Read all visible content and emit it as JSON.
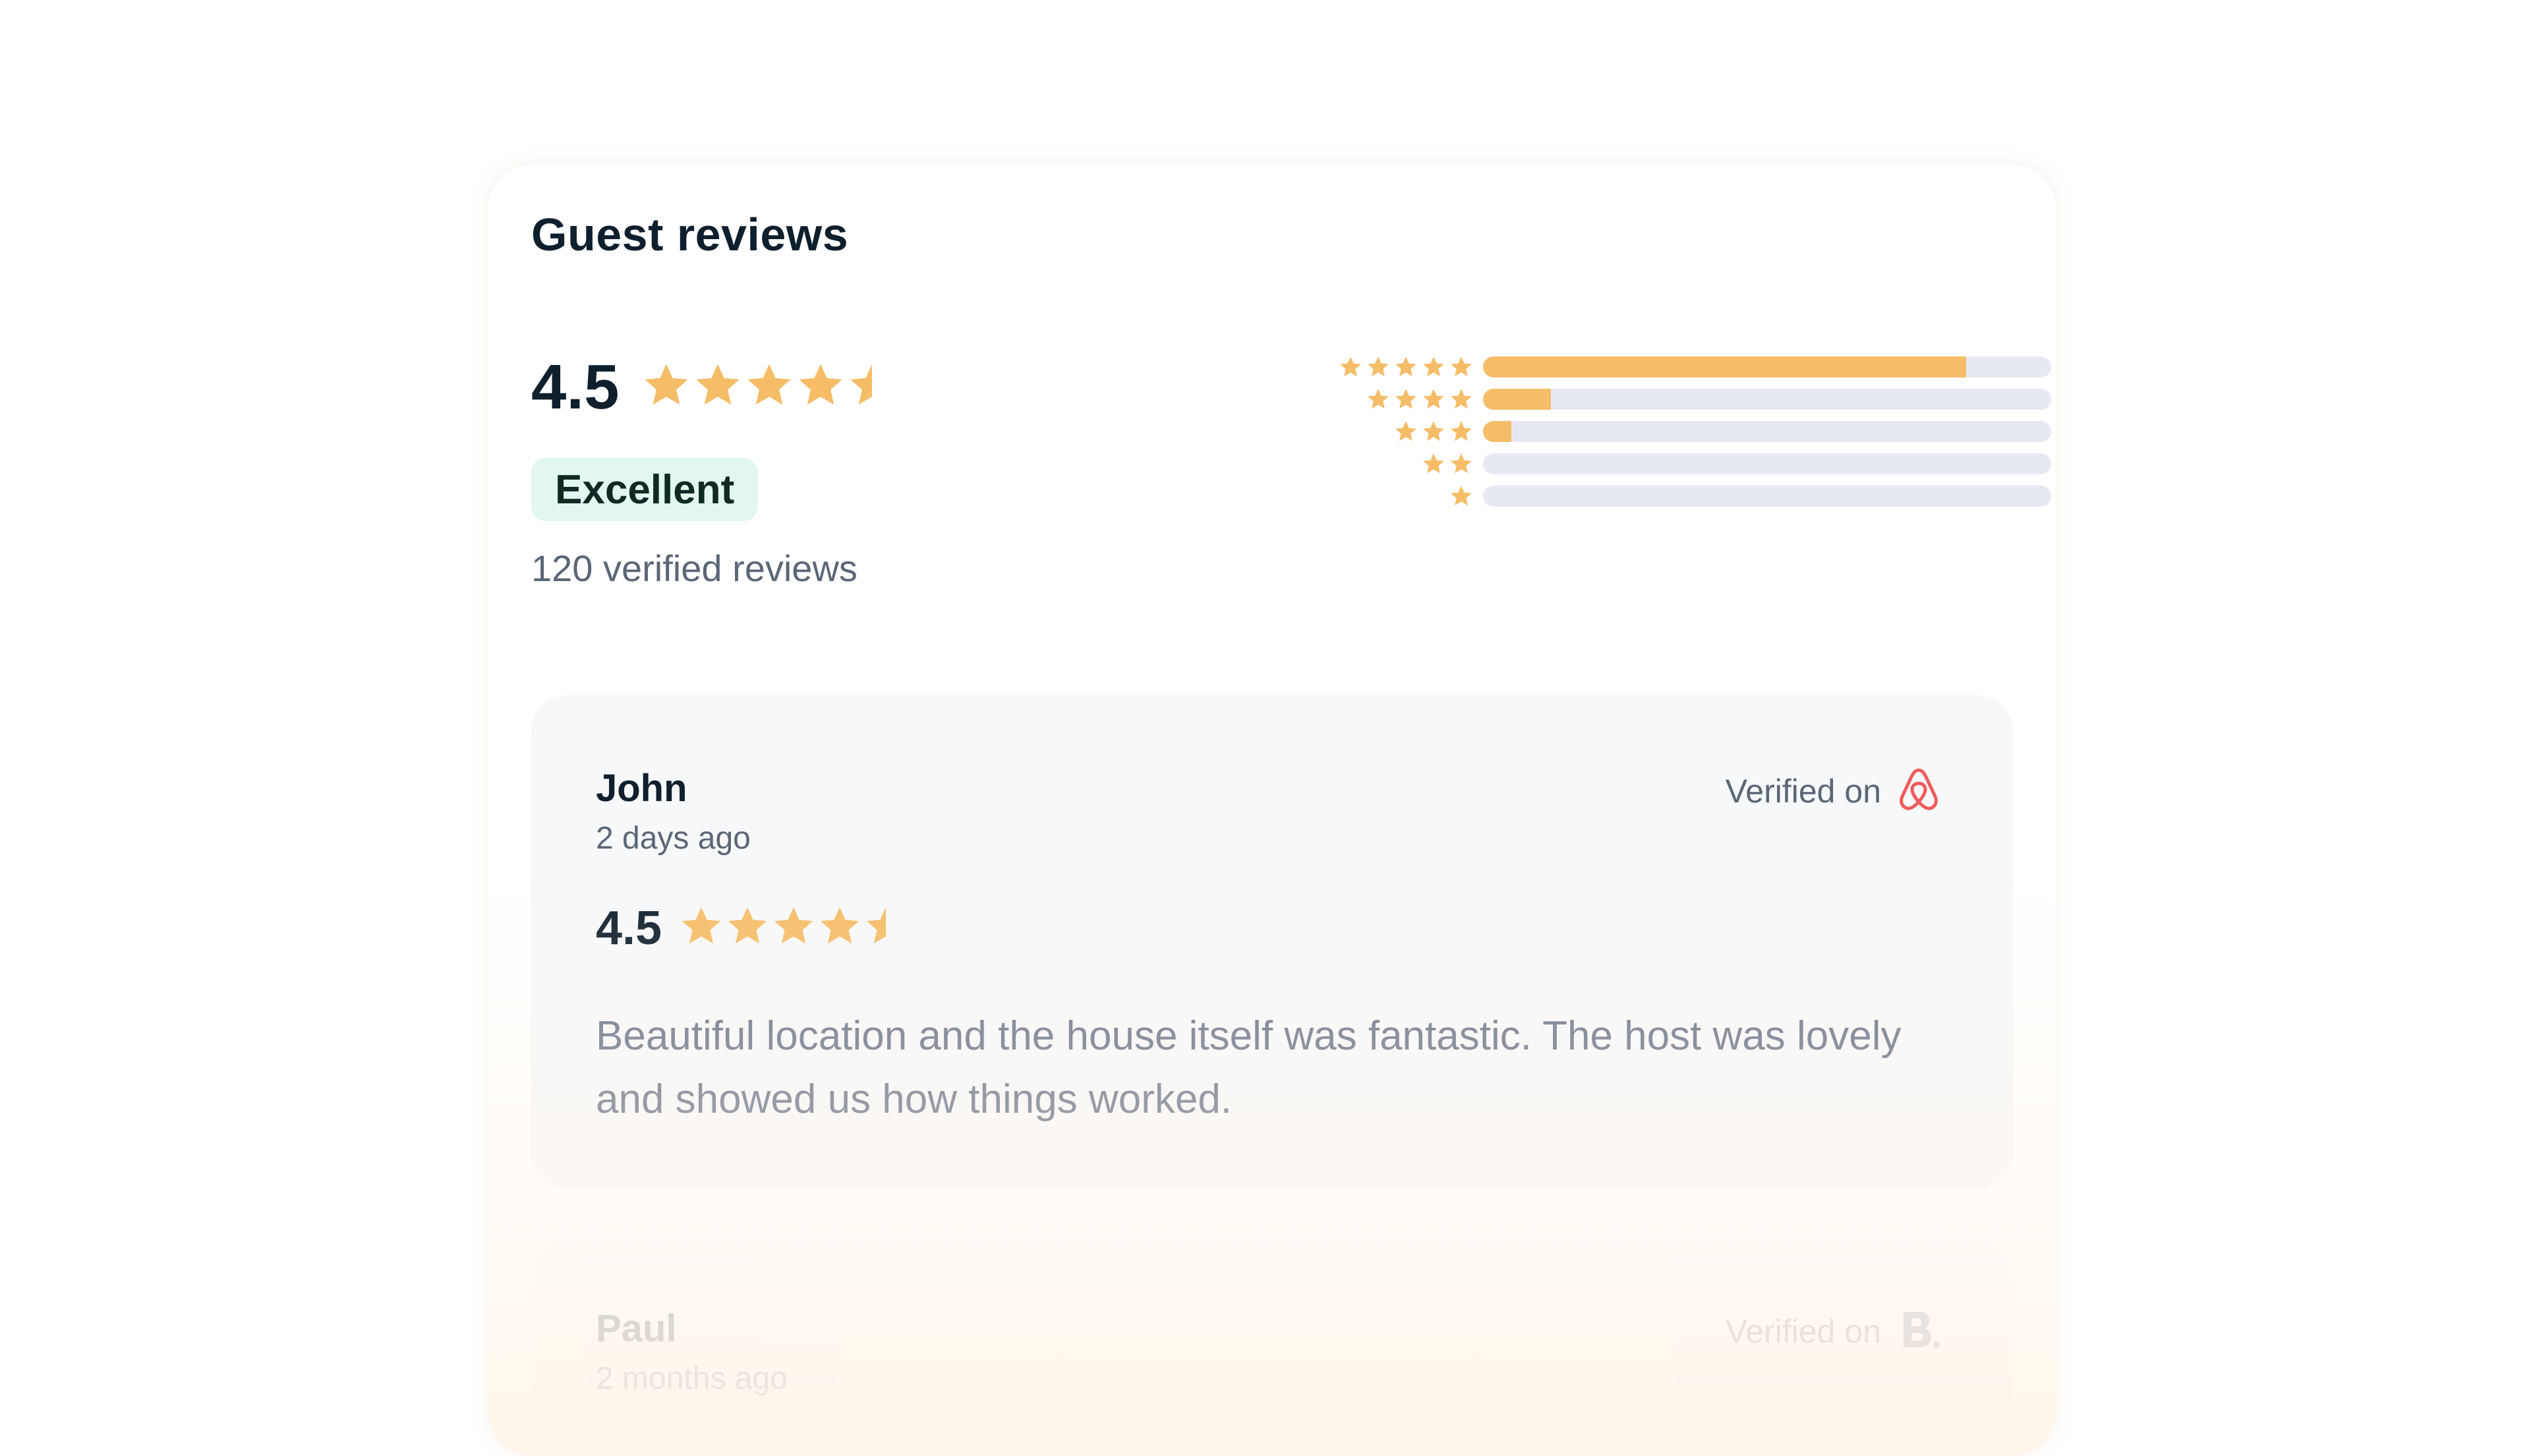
{
  "colors": {
    "accent_star": "#f5bd68",
    "badge_bg": "#e2f7ef",
    "track": "#e7e9f2",
    "airbnb": "#ef5b5b",
    "text_primary": "#0f1f2e",
    "text_secondary": "#5b6677"
  },
  "header": {
    "title": "Guest reviews"
  },
  "summary": {
    "score": "4.5",
    "rating": 4.5,
    "label": "Excellent",
    "review_count": "120 verified reviews"
  },
  "distribution": [
    {
      "stars": 5,
      "fraction": 0.85
    },
    {
      "stars": 4,
      "fraction": 0.12
    },
    {
      "stars": 3,
      "fraction": 0.05
    },
    {
      "stars": 2,
      "fraction": 0.0
    },
    {
      "stars": 1,
      "fraction": 0.0
    }
  ],
  "reviews": [
    {
      "name": "John",
      "date": "2 days ago",
      "verified_label": "Verified on",
      "platform_icon": "airbnb-logo-icon",
      "score": "4.5",
      "rating": 4.5,
      "text": "Beautiful location and the house itself was fantastic. The host was lovely and showed us how things worked."
    },
    {
      "name": "Paul",
      "date": "2 months ago",
      "verified_label": "Verified on",
      "platform_icon": "booking-logo-icon"
    }
  ]
}
